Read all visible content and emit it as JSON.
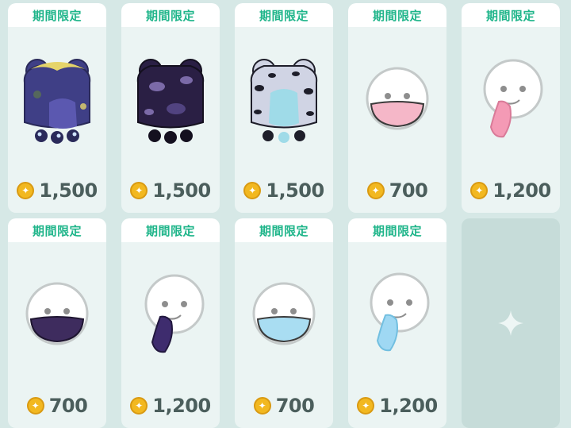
{
  "shop": {
    "items": [
      {
        "badge": "期間限定",
        "price": "1,500",
        "art": "frog-hat-dark-blue-icon",
        "colors": {
          "base": "#3f3f86",
          "accent": "#e5d46a"
        }
      },
      {
        "badge": "期間限定",
        "price": "1,500",
        "art": "frog-hat-black-icon",
        "colors": {
          "base": "#2a1f44",
          "accent": "#7b6aa8"
        }
      },
      {
        "badge": "期間限定",
        "price": "1,500",
        "art": "frog-hat-leopard-icon",
        "colors": {
          "base": "#d0d4e4",
          "accent": "#9fdbe8"
        }
      },
      {
        "badge": "期間限定",
        "price": "700",
        "art": "mask-pink-icon",
        "colors": {
          "base": "#ffffff",
          "accent": "#f5b7c8"
        }
      },
      {
        "badge": "期間限定",
        "price": "1,200",
        "art": "tongue-pink-icon",
        "colors": {
          "base": "#ffffff",
          "accent": "#f49ab5"
        }
      },
      {
        "badge": "期間限定",
        "price": "700",
        "art": "mask-dark-purple-icon",
        "colors": {
          "base": "#ffffff",
          "accent": "#3e2c5e"
        }
      },
      {
        "badge": "期間限定",
        "price": "1,200",
        "art": "tongue-dark-purple-icon",
        "colors": {
          "base": "#ffffff",
          "accent": "#3e2c6e"
        }
      },
      {
        "badge": "期間限定",
        "price": "700",
        "art": "mask-light-blue-icon",
        "colors": {
          "base": "#ffffff",
          "accent": "#a9ddf2"
        }
      },
      {
        "badge": "期間限定",
        "price": "1,200",
        "art": "tongue-light-blue-icon",
        "colors": {
          "base": "#ffffff",
          "accent": "#9fd8f3"
        }
      }
    ],
    "empty_slot_icon": "sparkle-icon",
    "coin_icon": "coin-icon",
    "colors": {
      "badge_text": "#1fb58a",
      "price_text": "#4b5e5c",
      "coin": "#f2b820",
      "background": "#d6e8e6",
      "card": "#ebf4f3"
    }
  }
}
